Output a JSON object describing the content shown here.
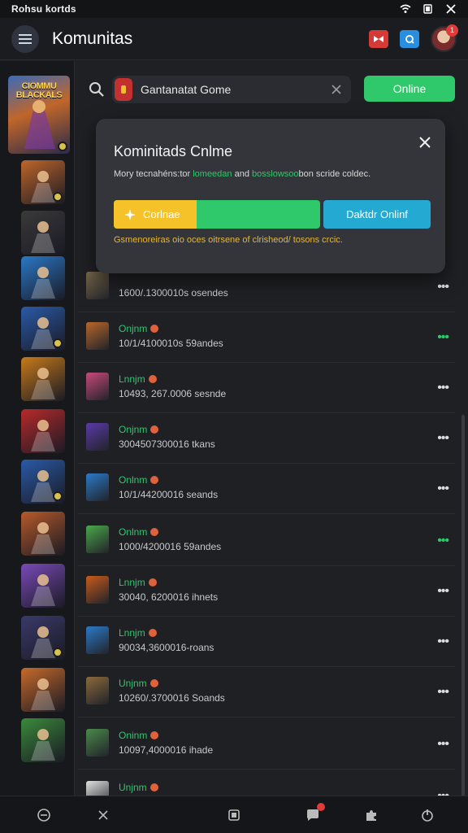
{
  "status_bar": {
    "carrier_text": "Rohsu kortds"
  },
  "app_bar": {
    "title": "Komunitas",
    "notification_count": "1"
  },
  "search": {
    "value": "Gantanatat Gome",
    "online_label": "Online"
  },
  "modal": {
    "title": "Kominitads Cnlme",
    "desc_part1": "Mory tecnahéns:tor ",
    "desc_hl1": "lomeedan",
    "desc_part2": " and ",
    "desc_hl2": "bosslowsoo",
    "desc_part3": "bon scride coldec.",
    "btn_left_label": "Corlnae",
    "btn_right_label": "Daktdr Onlinf",
    "note": "Gsmenoreiras oio oces oitrsene of clrisheod/ tosons crcic."
  },
  "featured_game": {
    "label": "CIOMMU BLACKALS"
  },
  "rows": [
    {
      "status": "",
      "meta": "1600/.1300010s osendes",
      "more_color": "#dcdcdc"
    },
    {
      "status": "Onjnm",
      "meta": "10/1/4100010s 59andes",
      "more_color": "#2fc86a"
    },
    {
      "status": "Lnnjm",
      "meta": "10493, 267.0006 sesnde",
      "more_color": "#dcdcdc"
    },
    {
      "status": "Onjnm",
      "meta": "3004507300016 tkans",
      "more_color": "#dcdcdc"
    },
    {
      "status": "Onlnm",
      "meta": "10/1/44200016 seands",
      "more_color": "#dcdcdc"
    },
    {
      "status": "Onlnm",
      "meta": "1000/4200016 59andes",
      "more_color": "#2fc86a"
    },
    {
      "status": "Lnnjm",
      "meta": "30040, 6200016 ihnets",
      "more_color": "#dcdcdc"
    },
    {
      "status": "Lnnjm",
      "meta": "90034,3600016-roans",
      "more_color": "#dcdcdc"
    },
    {
      "status": "Unjnm",
      "meta": "10260/.3700016 Soands",
      "more_color": "#dcdcdc"
    },
    {
      "status": "Oninm",
      "meta": "10097,4000016 ihade",
      "more_color": "#dcdcdc"
    },
    {
      "status": "Unjnm",
      "meta": "",
      "more_color": "#dcdcdc"
    }
  ],
  "thumb_colors": [
    "#c0662a",
    "#3a3a3a",
    "#2a78c8",
    "#2a5aa8",
    "#c87a1a",
    "#b82a2a",
    "#2a5aa8",
    "#b85a2a",
    "#7a4ab8",
    "#3a3a6a",
    "#c86a2a",
    "#3a8a3a"
  ],
  "row_icon_colors": [
    "#7a6a4a",
    "#b8662a",
    "#c84a7a",
    "#5a3aa8",
    "#2a7ac8",
    "#4aa84a",
    "#c85a1a",
    "#2a7ac8",
    "#8a6a3a",
    "#4a8a4a",
    "#e0e0e0"
  ],
  "accent": {
    "green": "#2fc86a",
    "yellow": "#f5c22a",
    "blue": "#23a9d2",
    "red": "#d63a36"
  }
}
